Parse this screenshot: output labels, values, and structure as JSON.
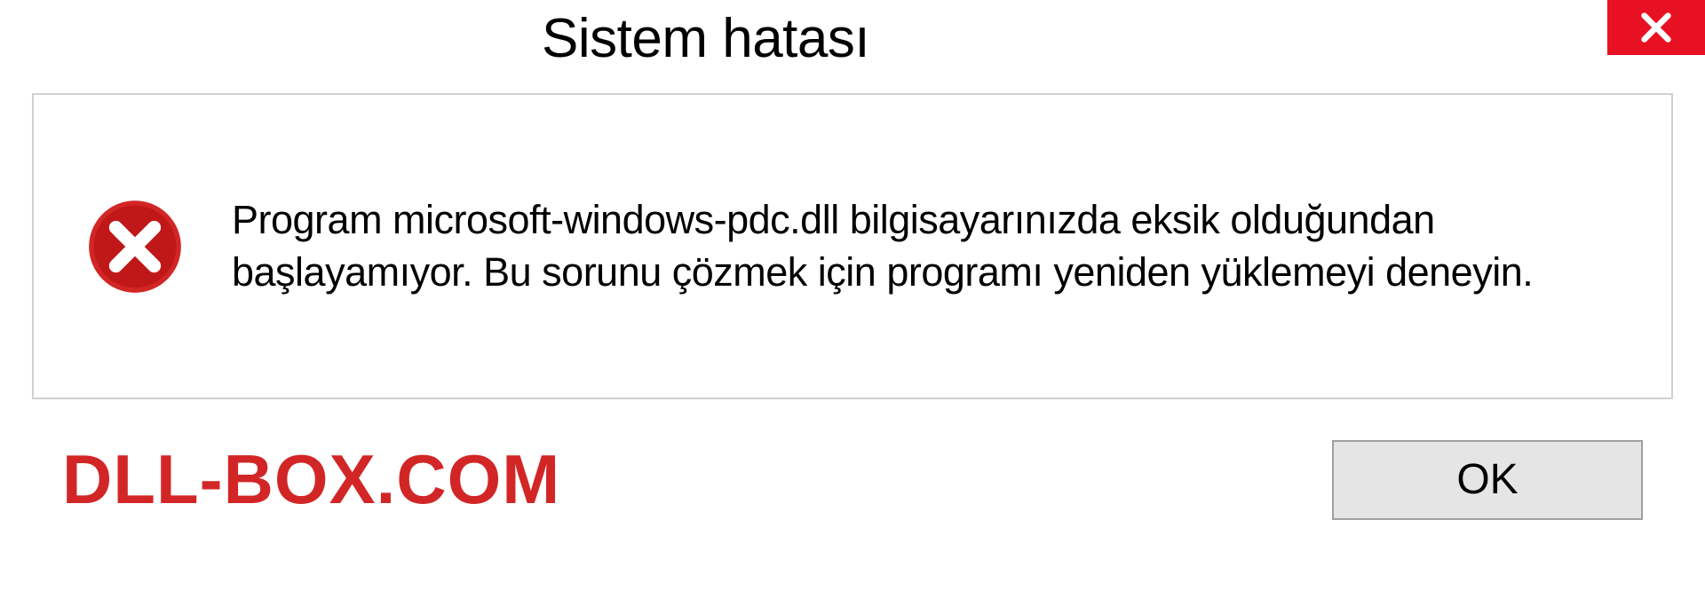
{
  "titlebar": {
    "title": "Sistem hatası"
  },
  "content": {
    "message": "Program microsoft-windows-pdc.dll bilgisayarınızda eksik olduğundan başlayamıyor. Bu sorunu çözmek için programı yeniden yüklemeyi deneyin."
  },
  "footer": {
    "watermark": "DLL-BOX.COM",
    "ok_label": "OK"
  },
  "colors": {
    "close_bg": "#e81123",
    "error_icon": "#d22626",
    "watermark": "#d22626"
  }
}
